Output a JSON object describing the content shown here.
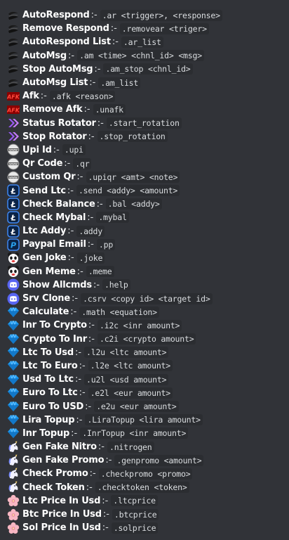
{
  "commands": [
    {
      "icon": "swirl-icon",
      "title": "AutoRespond",
      "sep": ":-",
      "code": ".ar <trigger>, <response>"
    },
    {
      "icon": "swirl-icon",
      "title": "Remove Respond",
      "sep": ":-",
      "code": ".removear <triger>"
    },
    {
      "icon": "swirl-icon",
      "title": "AutoRespond List",
      "sep": ":-",
      "code": ".ar_list"
    },
    {
      "icon": "swirl-icon",
      "title": "AutoMsg",
      "sep": ":-",
      "code": ".am <time> <chnl_id> <msg>"
    },
    {
      "icon": "swirl-icon",
      "title": "Stop AutoMsg",
      "sep": ":-",
      "code": ".am_stop <chnl_id>"
    },
    {
      "icon": "swirl-icon",
      "title": "AutoMsg List",
      "sep": ":-",
      "code": ".am_list"
    },
    {
      "icon": "afk-icon",
      "title": "Afk",
      "sep": ":-",
      "code": ".afk <reason>"
    },
    {
      "icon": "afk-icon",
      "title": "Remove Afk",
      "sep": ":-",
      "code": ".unafk"
    },
    {
      "icon": "chevrons-icon",
      "title": "Status Rotator",
      "sep": ":-",
      "code": ".start_rotation"
    },
    {
      "icon": "chevrons-icon",
      "title": "Stop Rotator",
      "sep": ":-",
      "code": ".stop_rotation"
    },
    {
      "icon": "globe-icon",
      "title": "Upi Id",
      "sep": ":-",
      "code": ".upi"
    },
    {
      "icon": "globe-icon",
      "title": "Qr Code",
      "sep": ":-",
      "code": ".qr"
    },
    {
      "icon": "globe-icon",
      "title": "Custom Qr",
      "sep": ":-",
      "code": ".upiqr <amt> <note>"
    },
    {
      "icon": "litecoin-icon",
      "title": "Send Ltc",
      "sep": ":-",
      "code": ".send <addy> <amount>"
    },
    {
      "icon": "litecoin-icon",
      "title": "Check Balance",
      "sep": ":-",
      "code": ".bal <addy>"
    },
    {
      "icon": "litecoin-icon",
      "title": "Check Mybal",
      "sep": ":-",
      "code": ".mybal"
    },
    {
      "icon": "litecoin-icon",
      "title": "Ltc Addy",
      "sep": ":-",
      "code": ".addy"
    },
    {
      "icon": "paypal-icon",
      "title": "Paypal Email",
      "sep": ":-",
      "code": ".pp"
    },
    {
      "icon": "panda-icon",
      "title": "Gen Joke",
      "sep": ":-",
      "code": ".joke"
    },
    {
      "icon": "panda-icon",
      "title": "Gen Meme",
      "sep": ":-",
      "code": ".meme"
    },
    {
      "icon": "discord-icon",
      "title": "Show Allcmds",
      "sep": ":-",
      "code": ".help"
    },
    {
      "icon": "discord-icon",
      "title": "Srv Clone",
      "sep": ":-",
      "code": ".csrv <copy id> <target id>"
    },
    {
      "icon": "diamond-icon",
      "title": "Calculate",
      "sep": ":-",
      "code": ".math <equation>"
    },
    {
      "icon": "diamond-icon",
      "title": "Inr To Crypto",
      "sep": ":-",
      "code": ".i2c <inr amount>"
    },
    {
      "icon": "diamond-icon",
      "title": "Crypto To Inr",
      "sep": ":-",
      "code": ".c2i <crypto amount>"
    },
    {
      "icon": "diamond-icon",
      "title": "Ltc To Usd",
      "sep": ":-",
      "code": ".l2u <ltc amount>"
    },
    {
      "icon": "diamond-icon",
      "title": "Ltc To Euro",
      "sep": ":-",
      "code": ".l2e <ltc amount>"
    },
    {
      "icon": "diamond-icon",
      "title": "Usd To Ltc",
      "sep": ":-",
      "code": ".u2l <usd amount>"
    },
    {
      "icon": "diamond-icon",
      "title": "Euro To Ltc",
      "sep": ":-",
      "code": ".e2l <eur amount>"
    },
    {
      "icon": "diamond-icon",
      "title": "Euro To USD",
      "sep": ":-",
      "code": ".e2u <eur amount>"
    },
    {
      "icon": "diamond-icon",
      "title": "Lira Topup",
      "sep": ":-",
      "code": ".LiraTopup <lira amount>"
    },
    {
      "icon": "diamond-icon",
      "title": "Inr Topup",
      "sep": ":-",
      "code": ".InrTopup <inr amount>"
    },
    {
      "icon": "unicorn-icon",
      "title": "Gen Fake Nitro",
      "sep": ":-",
      "code": ".nitrogen"
    },
    {
      "icon": "unicorn-icon",
      "title": "Gen Fake Promo",
      "sep": ":-",
      "code": ".genpromo <amount>"
    },
    {
      "icon": "unicorn-icon",
      "title": "Check Promo",
      "sep": ":-",
      "code": ".checkpromo <promo>"
    },
    {
      "icon": "unicorn-icon",
      "title": "Check Token",
      "sep": ":-",
      "code": ".checktoken <token>"
    },
    {
      "icon": "flower-icon",
      "title": "Ltc Price In Usd",
      "sep": ":-",
      "code": ".ltcprice"
    },
    {
      "icon": "flower-icon",
      "title": "Btc Price In Usd",
      "sep": ":-",
      "code": ".btcprice"
    },
    {
      "icon": "flower-icon",
      "title": "Sol Price In Usd",
      "sep": ":-",
      "code": ".solprice"
    }
  ],
  "colors": {
    "background": "#313338",
    "code_background": "#2b2d31",
    "title": "#ffffff",
    "text": "#dbdee1"
  }
}
